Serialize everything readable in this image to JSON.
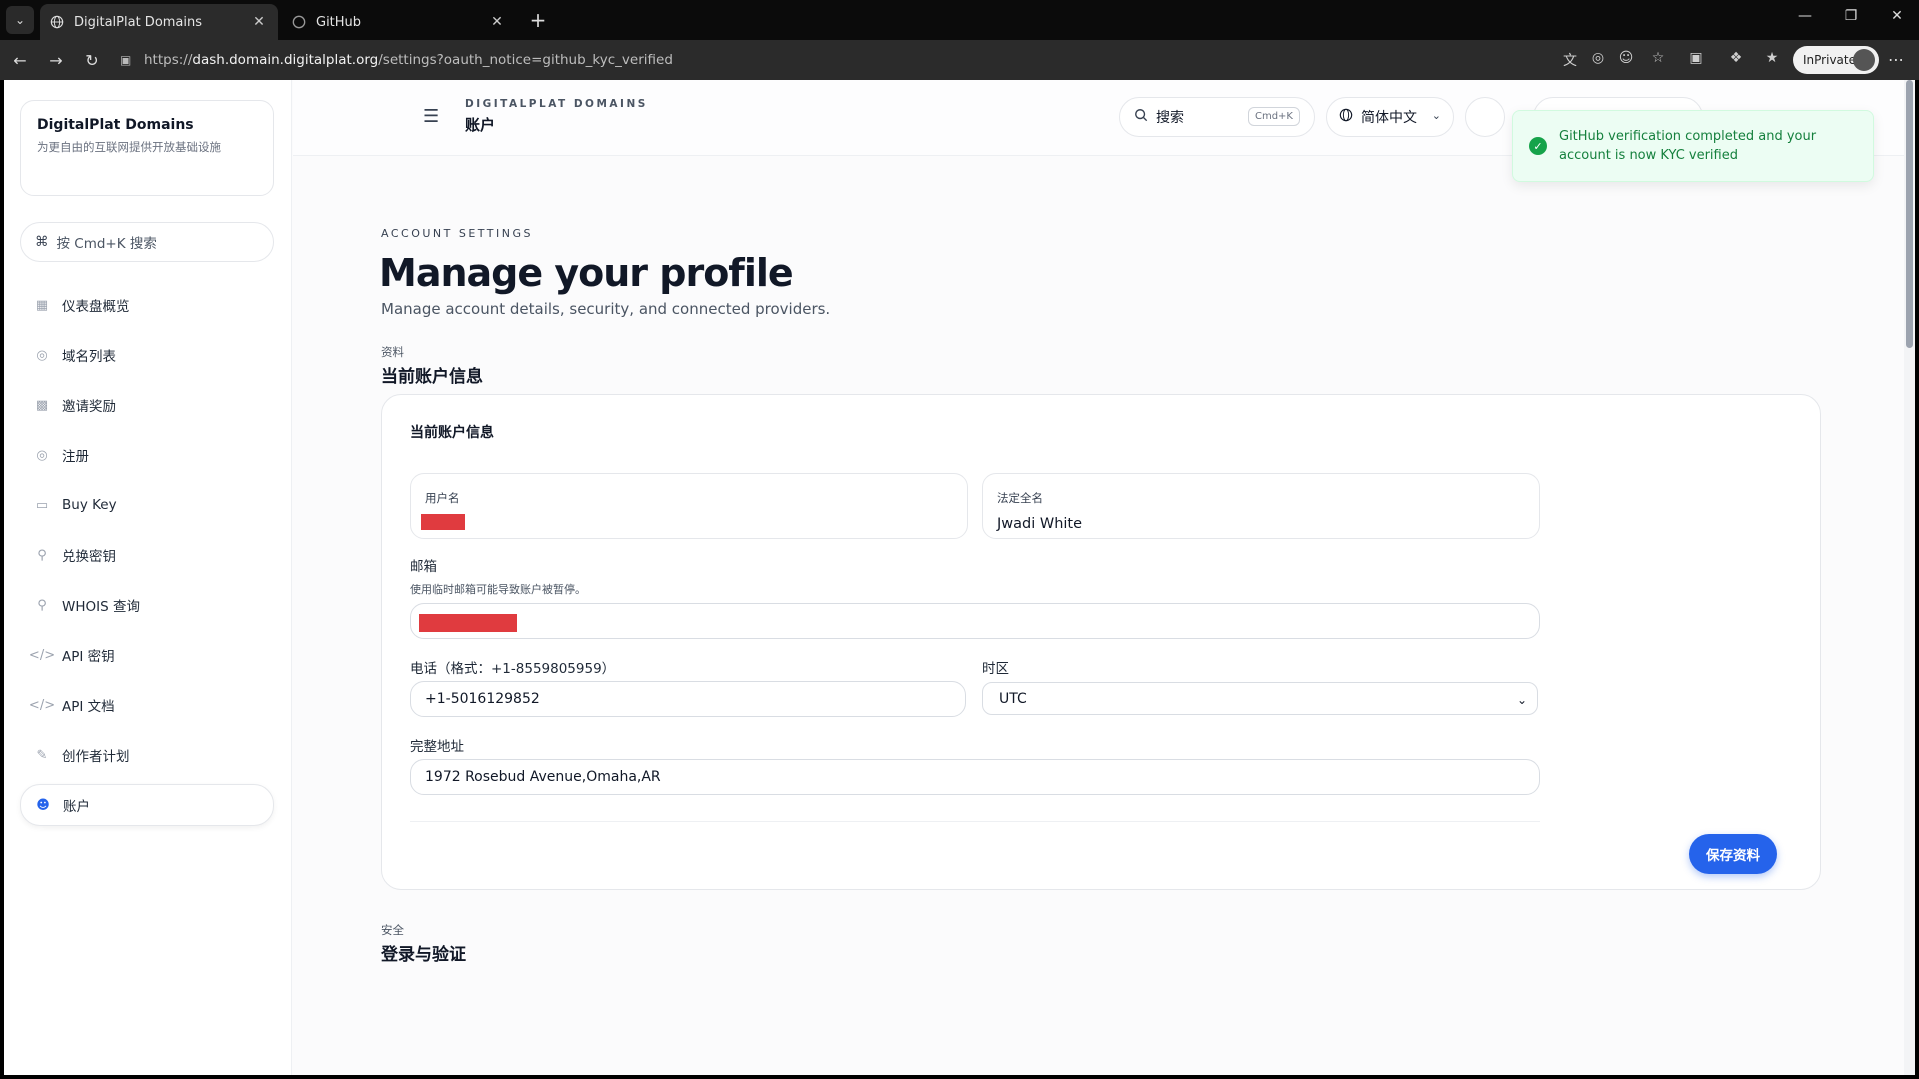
{
  "browser": {
    "tabs": [
      {
        "title": "DigitalPlat Domains",
        "icon": "globe-icon",
        "active": true
      },
      {
        "title": "GitHub",
        "icon": "github-icon",
        "active": false
      }
    ],
    "url_scheme": "https://",
    "url_host": "dash.domain.digitalplat.org",
    "url_path": "/settings?oauth_notice=github_kyc_verified",
    "inprivate_label": "InPrivate"
  },
  "sidebar": {
    "brand_title": "DigitalPlat Domains",
    "brand_subtitle": "为更自由的互联网提供开放基础设施",
    "search_placeholder": "按 Cmd+K 搜索",
    "items": [
      {
        "label": "仪表盘概览",
        "icon": "dashboard-icon"
      },
      {
        "label": "域名列表",
        "icon": "globe-icon"
      },
      {
        "label": "邀请奖励",
        "icon": "gift-icon"
      },
      {
        "label": "注册",
        "icon": "globe-icon"
      },
      {
        "label": "Buy Key",
        "icon": "card-icon"
      },
      {
        "label": "兑换密钥",
        "icon": "key-icon"
      },
      {
        "label": "WHOIS 查询",
        "icon": "search-icon"
      },
      {
        "label": "API 密钥",
        "icon": "code-icon"
      },
      {
        "label": "API 文档",
        "icon": "code-icon"
      },
      {
        "label": "创作者计划",
        "icon": "edit-icon"
      },
      {
        "label": "账户",
        "icon": "user-icon",
        "active": true
      }
    ]
  },
  "header": {
    "kicker": "DIGITALPLAT DOMAINS",
    "title": "账户",
    "search_label": "搜索",
    "search_shortcut": "Cmd+K",
    "language": "简体中文"
  },
  "toast": {
    "message": "GitHub verification completed and your account is now KYC verified"
  },
  "page": {
    "kicker": "ACCOUNT SETTINGS",
    "title": "Manage your profile",
    "description": "Manage account details, security, and connected providers.",
    "section_kicker": "资料",
    "section_title": "当前账户信息",
    "card_title": "当前账户信息",
    "username_label": "用户名",
    "fullname_label": "法定全名",
    "fullname_value": "Jwadi White",
    "email_label": "邮箱",
    "email_hint": "使用临时邮箱可能导致账户被暂停。",
    "phone_label": "电话（格式：+1-8559805959）",
    "phone_value": "+1-5016129852",
    "timezone_label": "时区",
    "timezone_value": "UTC",
    "address_label": "完整地址",
    "address_value": "1972  Rosebud Avenue,Omaha,AR",
    "save_label": "保存资料",
    "section2_kicker": "安全",
    "section2_title": "登录与验证"
  },
  "colors": {
    "accent": "#2563eb",
    "success": "#16a34a",
    "redaction": "#e03b3f"
  }
}
